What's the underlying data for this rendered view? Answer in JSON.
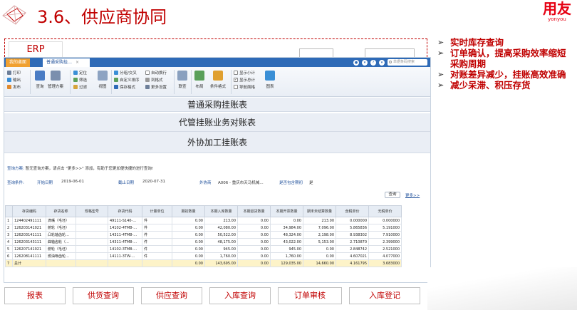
{
  "slide": {
    "title": "3.6、供应商协同",
    "logo_main": "用友",
    "logo_sub": "yonyou"
  },
  "erp_label": "ERP",
  "app": {
    "tabs": {
      "home": "我的桌面",
      "active": "普通采购挂…"
    },
    "search_placeholder": "单据条码搜索",
    "toolbar": {
      "print": "打印",
      "export": "输出",
      "publish": "发布",
      "query": "查询",
      "manage_scheme": "管理方案",
      "locate": "定位",
      "filter": "筛选",
      "filter2": "过滤",
      "view": "视图",
      "group_cross": "分组/交叉",
      "custom_sort": "自定义排序",
      "save_format": "保存格式",
      "auto_wrap": "自动换行",
      "decimal": "到格式",
      "more_settings": "更多设置",
      "linkage": "联查",
      "layout": "布局",
      "condition_format": "条件格式",
      "show_subtotal": "显示小计",
      "show_total": "显示总计",
      "mapping_grid": "导航面格",
      "chart": "图表"
    },
    "banners": [
      "普通采购挂账表",
      "代管挂账业务对账表",
      "外协加工挂账表"
    ],
    "scheme": {
      "label": "查询方案:",
      "text": "暂无查询方案，请点击 \"更多>>\" 添加，有助于您更加便快捷的进行查询!"
    },
    "conditions": {
      "label": "查询条件:",
      "start_label": "开始日期",
      "start_value": "2019-06-01",
      "end_label": "截止日期",
      "end_value": "2020-07-31",
      "vendor_label": "外协商",
      "vendor_value": "A006 - 重庆市天马机械…",
      "include_label": "是否包含期初",
      "include_value": "是"
    },
    "query_btn": "查询",
    "more_link": "更多>>",
    "table": {
      "headers": [
        "",
        "存货编码",
        "存货名称",
        "规格型号",
        "存货代码",
        "计量单位",
        "期初数量",
        "本期入库数量",
        "本期退货数量",
        "本期开票数量",
        "期末未结算数量",
        "含税单价",
        "无税单价"
      ],
      "rows": [
        [
          "1",
          "124402491111",
          "滴嘴（毛坯）",
          "",
          "49111-S140-…",
          "件",
          "0.00",
          "213.00",
          "0.00",
          "0.00",
          "213.00",
          "0.000000",
          "0.000000"
        ],
        [
          "2",
          "126203141021",
          "俯轮（毛坯）",
          "",
          "14102-4TM8-…",
          "件",
          "0.00",
          "42,080.00",
          "0.00",
          "34,984.00",
          "7,096.00",
          "5.865836",
          "5.191000"
        ],
        [
          "3",
          "126203141111",
          "凸轮轴齿轮…",
          "",
          "14311-4TM8-…",
          "件",
          "0.00",
          "50,522.00",
          "0.00",
          "48,324.00",
          "2,198.00",
          "8.938302",
          "7.910000"
        ],
        [
          "4",
          "126203143111",
          "曲轴齿轮（…",
          "",
          "14311-4TM8-…",
          "件",
          "0.00",
          "48,175.00",
          "0.00",
          "43,022.00",
          "5,153.00",
          "2.710870",
          "2.399000"
        ],
        [
          "5",
          "126207141021",
          "俯轮（毛坯）",
          "",
          "14102-3TM8-…",
          "件",
          "0.00",
          "945.00",
          "0.00",
          "945.00",
          "0.00",
          "2.848742",
          "2.521000"
        ],
        [
          "6",
          "126208141111",
          "燃油啄齿轮…",
          "",
          "14111-3TW-…",
          "件",
          "0.00",
          "1,760.00",
          "0.00",
          "1,760.00",
          "0.00",
          "4.607021",
          "4.077000"
        ]
      ],
      "total": [
        "7",
        "总计",
        "",
        "",
        "",
        "",
        "0.00",
        "143,695.00",
        "0.00",
        "129,035.00",
        "14,660.00",
        "4.161795",
        "3.683000"
      ]
    }
  },
  "bottom_tabs": [
    "报表",
    "供货查询",
    "供应查询",
    "入库查询",
    "订单审核",
    "入库登记"
  ],
  "bullets": [
    "实时库存查询",
    "订单确认，提高采购效率缩短采购周期",
    "对账差异减少，挂账高效准确",
    "减少呆滞、积压存货"
  ]
}
